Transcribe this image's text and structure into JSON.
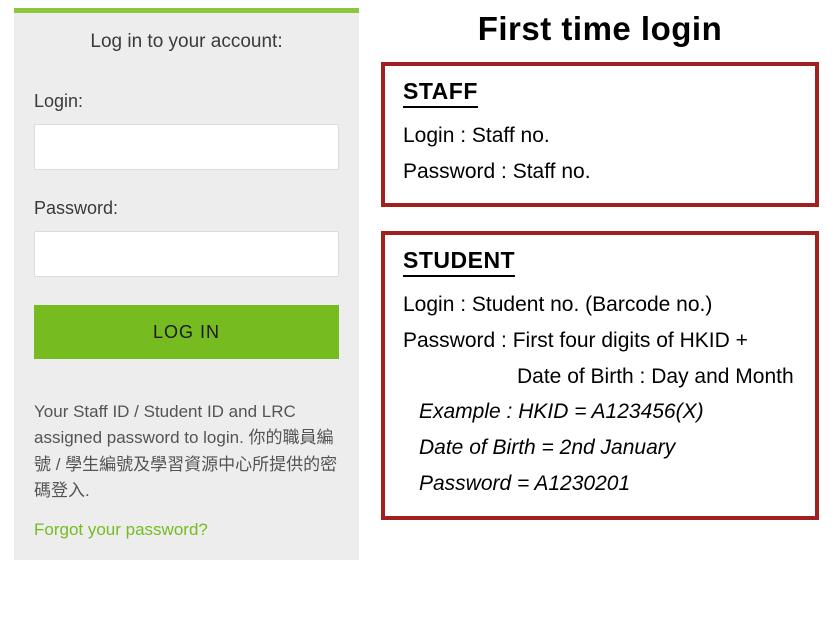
{
  "login_panel": {
    "title": "Log in to your account:",
    "login_label": "Login:",
    "password_label": "Password:",
    "button_label": "LOG IN",
    "help_text_en": "Your Staff ID / Student ID and LRC assigned password to login.",
    "help_text_zh": "你的職員編號 / 學生編號及學習資源中心所提供的密碼登入.",
    "forgot_link": "Forgot your password?"
  },
  "info_panel": {
    "heading": "First time login",
    "staff": {
      "title": "STAFF",
      "login_line": "Login  :  Staff no.",
      "password_line": "Password :  Staff no."
    },
    "student": {
      "title": "STUDENT",
      "login_line": "Login :  Student no. (Barcode no.)",
      "password_label": "Password  :  First four digits of HKID +",
      "password_detail": "Date of Birth : Day  and Month",
      "example_label": "Example :  HKID = A123456(X)",
      "example_dob": "Date of Birth = 2nd January",
      "example_pw": "Password  = A1230201"
    }
  }
}
